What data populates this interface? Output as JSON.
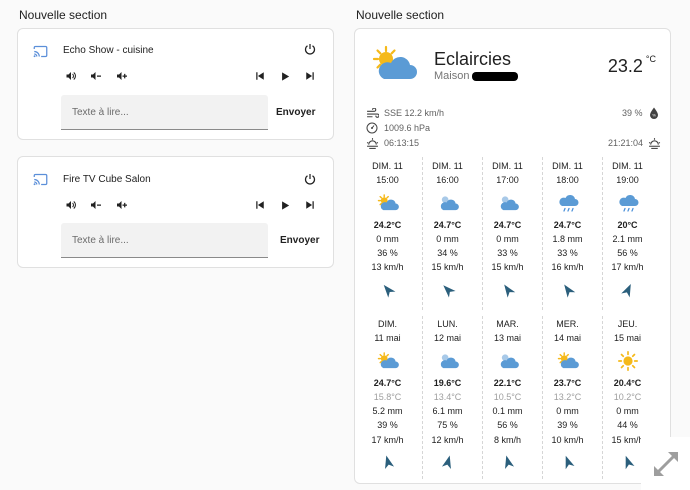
{
  "sections": [
    {
      "title": "Nouvelle section"
    },
    {
      "title": "Nouvelle section"
    }
  ],
  "media_players": [
    {
      "name": "Echo Show - cuisine",
      "tts_placeholder": "Texte à lire...",
      "send_label": "Envoyer"
    },
    {
      "name": "Fire TV Cube Salon",
      "tts_placeholder": "Texte à lire...",
      "send_label": "Envoyer"
    }
  ],
  "weather": {
    "state": "Eclaircies",
    "name": "Maison",
    "temperature": "23.2",
    "unit": "°C",
    "wind": "SSE 12.2 km/h",
    "humidity": "39 %",
    "pressure": "1009.6 hPa",
    "sunrise": "06:13:15",
    "sunset": "21:21:04",
    "hourly": [
      {
        "day": "DIM. 11",
        "time": "15:00",
        "icon": "partly-cloudy-icon",
        "temp": "24.2°C",
        "precip": "0 mm",
        "precip_prob": "36 %",
        "wind": "13 km/h",
        "wind_deg": 320
      },
      {
        "day": "DIM. 11",
        "time": "16:00",
        "icon": "cloudy-sun-icon",
        "temp": "24.7°C",
        "precip": "0 mm",
        "precip_prob": "34 %",
        "wind": "15 km/h",
        "wind_deg": 315
      },
      {
        "day": "DIM. 11",
        "time": "17:00",
        "icon": "cloudy-sun-icon",
        "temp": "24.7°C",
        "precip": "0 mm",
        "precip_prob": "33 %",
        "wind": "15 km/h",
        "wind_deg": 325
      },
      {
        "day": "DIM. 11",
        "time": "18:00",
        "icon": "rainy-icon",
        "temp": "24.7°C",
        "precip": "1.8 mm",
        "precip_prob": "33 %",
        "wind": "16 km/h",
        "wind_deg": 325
      },
      {
        "day": "DIM. 11",
        "time": "19:00",
        "icon": "rainy-icon",
        "temp": "20°C",
        "precip": "2.1 mm",
        "precip_prob": "56 %",
        "wind": "17 km/h",
        "wind_deg": 25
      }
    ],
    "daily": [
      {
        "day": "DIM.",
        "date": "11 mai",
        "icon": "partly-cloudy-icon",
        "temp_high": "24.7°C",
        "temp_low": "15.8°C",
        "precip": "5.2 mm",
        "precip_prob": "39 %",
        "wind": "17 km/h",
        "wind_deg": 345
      },
      {
        "day": "LUN.",
        "date": "12 mai",
        "icon": "cloudy-sun-icon",
        "temp_high": "19.6°C",
        "temp_low": "13.4°C",
        "precip": "6.1 mm",
        "precip_prob": "75 %",
        "wind": "12 km/h",
        "wind_deg": 15
      },
      {
        "day": "MAR.",
        "date": "13 mai",
        "icon": "cloudy-sun-icon",
        "temp_high": "22.1°C",
        "temp_low": "10.5°C",
        "precip": "0.1 mm",
        "precip_prob": "56 %",
        "wind": "8 km/h",
        "wind_deg": 345
      },
      {
        "day": "MER.",
        "date": "14 mai",
        "icon": "partly-cloudy-icon",
        "temp_high": "23.7°C",
        "temp_low": "13.2°C",
        "precip": "0 mm",
        "precip_prob": "39 %",
        "wind": "10 km/h",
        "wind_deg": 340
      },
      {
        "day": "JEU.",
        "date": "15 mai",
        "icon": "sunny-icon",
        "temp_high": "20.4°C",
        "temp_low": "10.2°C",
        "precip": "0 mm",
        "precip_prob": "44 %",
        "wind": "15 km/h",
        "wind_deg": 340
      }
    ]
  },
  "colors": {
    "icon": "#212121",
    "cloud": "#5b9bd5",
    "sun": "#f5b91a",
    "wind_arrow": "#2b5f7c",
    "drop": "#4a90d9"
  }
}
